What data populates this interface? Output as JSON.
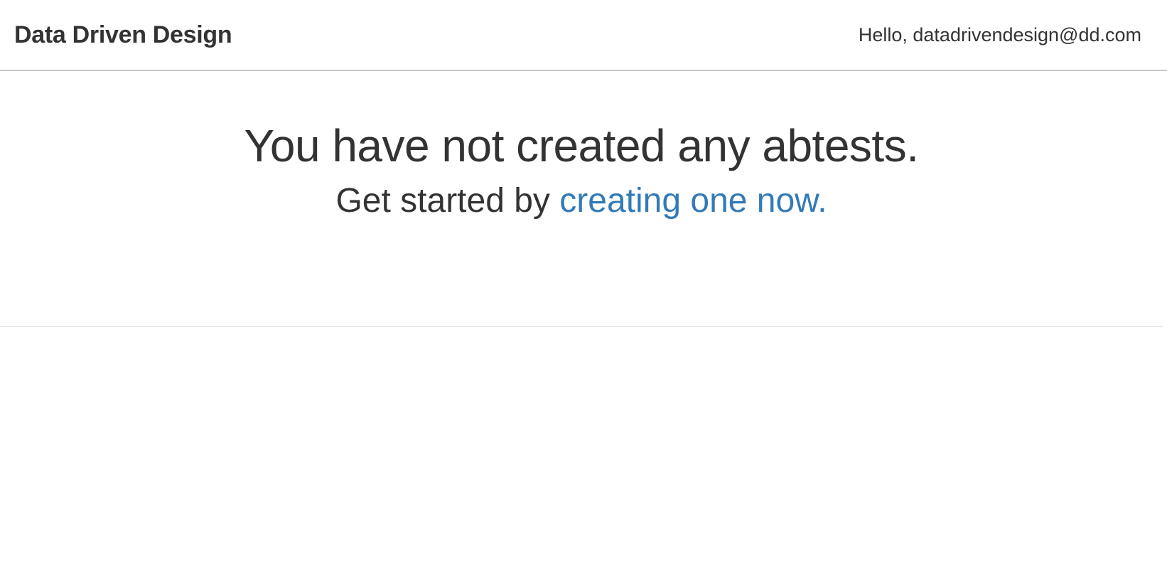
{
  "navbar": {
    "brand": "Data Driven Design",
    "greeting": "Hello, datadrivendesign@dd.com"
  },
  "empty_state": {
    "headline": "You have not created any abtests.",
    "sub_prefix": "Get started by ",
    "cta_link": "creating one now."
  },
  "colors": {
    "text": "#333333",
    "link": "#337ab7",
    "divider": "#c8c8c8"
  }
}
